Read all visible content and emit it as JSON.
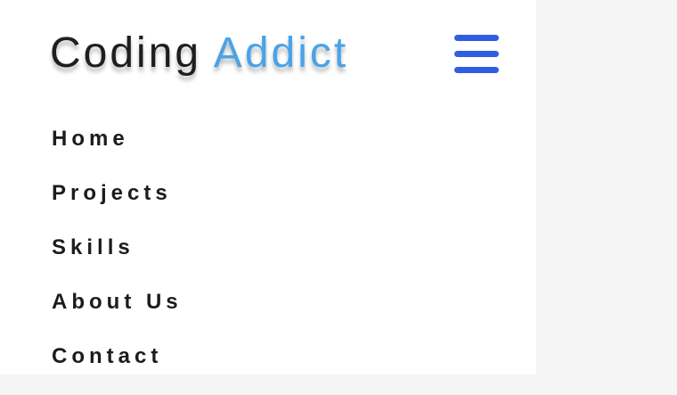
{
  "brand": {
    "first_word": "Coding",
    "second_word": "Addict",
    "accent_color": "#4aa3e8"
  },
  "menu_toggle": {
    "icon": "hamburger-menu-icon",
    "color": "#2f5fe0"
  },
  "nav": {
    "items": [
      {
        "label": "Home"
      },
      {
        "label": "Projects"
      },
      {
        "label": "Skills"
      },
      {
        "label": "About Us"
      },
      {
        "label": "Contact"
      }
    ]
  }
}
